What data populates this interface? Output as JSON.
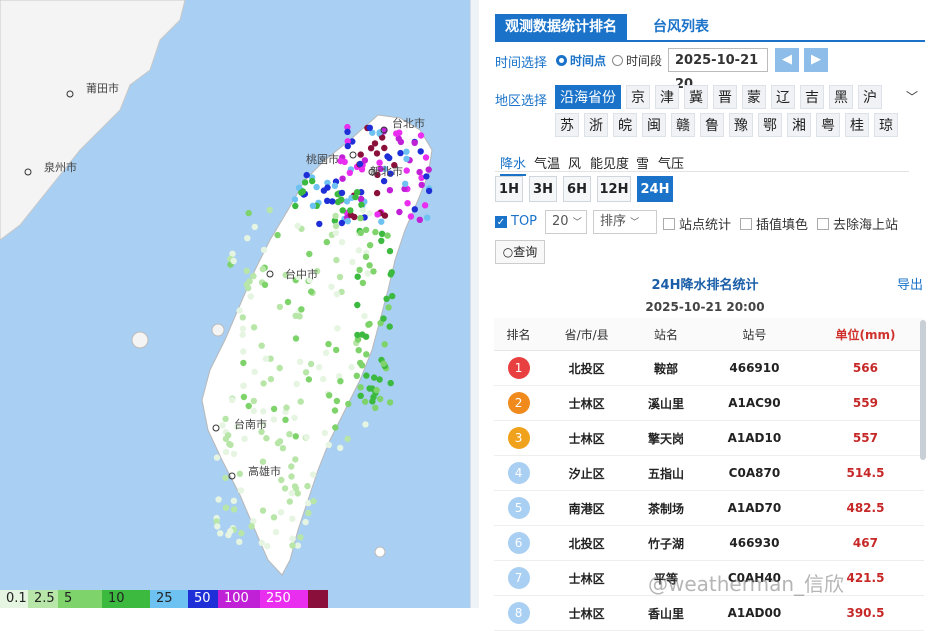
{
  "map": {
    "cities": [
      {
        "name": "台北市"
      },
      {
        "name": "新北市"
      },
      {
        "name": "桃園市"
      },
      {
        "name": "台中市"
      },
      {
        "name": "台南市"
      },
      {
        "name": "高雄市"
      },
      {
        "name": "莆田市"
      },
      {
        "name": "泉州市"
      }
    ],
    "legend": [
      {
        "label": "0.1",
        "color": "#e6f5e1"
      },
      {
        "label": "2.5",
        "color": "#b8e6a8"
      },
      {
        "label": "5",
        "color": "#7ed36b"
      },
      {
        "label": "10",
        "color": "#3cb93f"
      },
      {
        "label": "25",
        "color": "#6ec2f2"
      },
      {
        "label": "50",
        "color": "#1e2fd8"
      },
      {
        "label": "100",
        "color": "#c021d6"
      },
      {
        "label": "250",
        "color": "#ea2ef0"
      },
      {
        "label": "",
        "color": "#8a0f3a"
      }
    ]
  },
  "panel": {
    "tabs": {
      "active": "观测数据统计排名",
      "inactive": "台风列表"
    },
    "time_label": "时间选择",
    "radio_point": "时间点",
    "radio_range": "时间段",
    "date_value": "2025-10-21 20",
    "region_label": "地区选择",
    "regions_row1": [
      "沿海省份",
      "京",
      "津",
      "冀",
      "晋",
      "蒙",
      "辽",
      "吉",
      "黑",
      "沪"
    ],
    "regions_row2": [
      "苏",
      "浙",
      "皖",
      "闽",
      "赣",
      "鲁",
      "豫",
      "鄂",
      "湘",
      "粤",
      "桂",
      "琼"
    ],
    "variables": [
      "降水",
      "气温",
      "风",
      "能见度",
      "雪",
      "气压"
    ],
    "periods": [
      "1H",
      "3H",
      "6H",
      "12H",
      "24H"
    ],
    "top_label": "TOP",
    "top_value": "20",
    "sort_label": "排序",
    "opt_station": "站点统计",
    "opt_interp": "插值填色",
    "opt_sea": "去除海上站",
    "query_label": "查询",
    "ranking_title": "24H降水排名统计",
    "export_label": "导出",
    "ranking_time": "2025-10-21 20:00",
    "columns": [
      "排名",
      "省/市/县",
      "站名",
      "站号",
      "单位(mm)"
    ],
    "rows": [
      {
        "rank": "1",
        "area": "北投区",
        "station": "鞍部",
        "id": "466910",
        "value": "566",
        "color": "#e84040"
      },
      {
        "rank": "2",
        "area": "士林区",
        "station": "溪山里",
        "id": "A1AC90",
        "value": "559",
        "color": "#f08a1c"
      },
      {
        "rank": "3",
        "area": "士林区",
        "station": "擎天岗",
        "id": "A1AD10",
        "value": "557",
        "color": "#f0a21c"
      },
      {
        "rank": "4",
        "area": "汐止区",
        "station": "五指山",
        "id": "C0A870",
        "value": "514.5",
        "color": "#a9cff2"
      },
      {
        "rank": "5",
        "area": "南港区",
        "station": "茶制场",
        "id": "A1AD70",
        "value": "482.5",
        "color": "#a9cff2"
      },
      {
        "rank": "6",
        "area": "北投区",
        "station": "竹子湖",
        "id": "466930",
        "value": "467",
        "color": "#a9cff2"
      },
      {
        "rank": "7",
        "area": "士林区",
        "station": "平等",
        "id": "C0AH40",
        "value": "421.5",
        "color": "#a9cff2"
      },
      {
        "rank": "8",
        "area": "士林区",
        "station": "香山里",
        "id": "A1AD00",
        "value": "390.5",
        "color": "#a9cff2"
      }
    ],
    "watermark": "@weatherman_信欣"
  }
}
